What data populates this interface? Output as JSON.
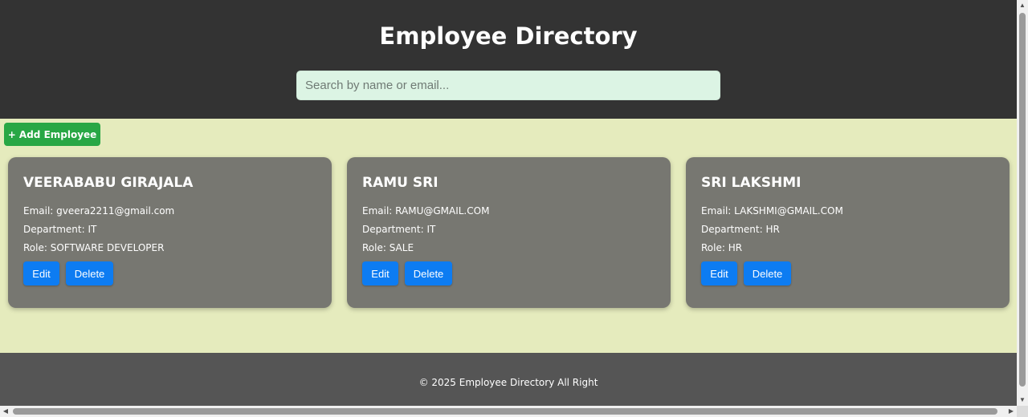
{
  "header": {
    "title": "Employee Directory",
    "search_placeholder": "Search by name or email..."
  },
  "toolbar": {
    "add_label": "+ Add Employee"
  },
  "employees": [
    {
      "name": "VEERABABU GIRAJALA",
      "email": "Email: gveera2211@gmail.com",
      "department": "Department: IT",
      "role": "Role: SOFTWARE DEVELOPER",
      "edit_label": "Edit",
      "delete_label": "Delete"
    },
    {
      "name": "RAMU SRI",
      "email": "Email: RAMU@GMAIL.COM",
      "department": "Department: IT",
      "role": "Role: SALE",
      "edit_label": "Edit",
      "delete_label": "Delete"
    },
    {
      "name": "SRI LAKSHMI",
      "email": "Email: LAKSHMI@GMAIL.COM",
      "department": "Department: HR",
      "role": "Role: HR",
      "edit_label": "Edit",
      "delete_label": "Delete"
    }
  ],
  "footer": {
    "text": "© 2025 Employee Directory All Right"
  },
  "colors": {
    "header_bg": "#333333",
    "content_bg": "#e5ebbd",
    "card_bg": "#777771",
    "add_button": "#28a745",
    "action_button": "#0d7cf2",
    "footer_bg": "#555555"
  },
  "scrollbars": {
    "up_icon": "scroll-up-arrow-icon",
    "down_icon": "scroll-down-arrow-icon",
    "left_icon": "scroll-left-arrow-icon",
    "right_icon": "scroll-right-arrow-icon"
  }
}
